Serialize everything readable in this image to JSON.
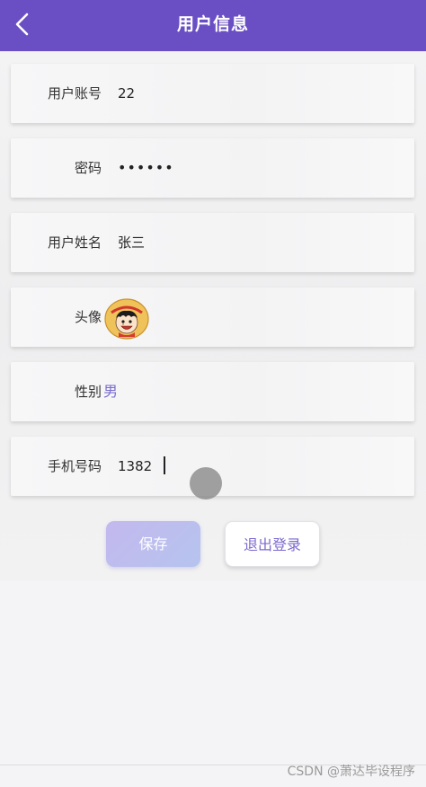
{
  "header": {
    "title": "用户信息",
    "back_icon": "chevron-left-icon"
  },
  "form": {
    "account": {
      "label": "用户账号",
      "value": "22"
    },
    "password": {
      "label": "密码",
      "value": "••••••"
    },
    "name": {
      "label": "用户姓名",
      "value": "张三"
    },
    "avatar": {
      "label": "头像",
      "icon": "avatar-image"
    },
    "gender": {
      "label": "性别",
      "value": "男"
    },
    "phone": {
      "label": "手机号码",
      "value": "1382"
    }
  },
  "actions": {
    "save_label": "保存",
    "logout_label": "退出登录"
  },
  "watermark": "CSDN @萧达毕设程序",
  "colors": {
    "navbar": "#6a4fc4",
    "accent": "#7d69cf",
    "save_button": "#c3b8ee"
  }
}
